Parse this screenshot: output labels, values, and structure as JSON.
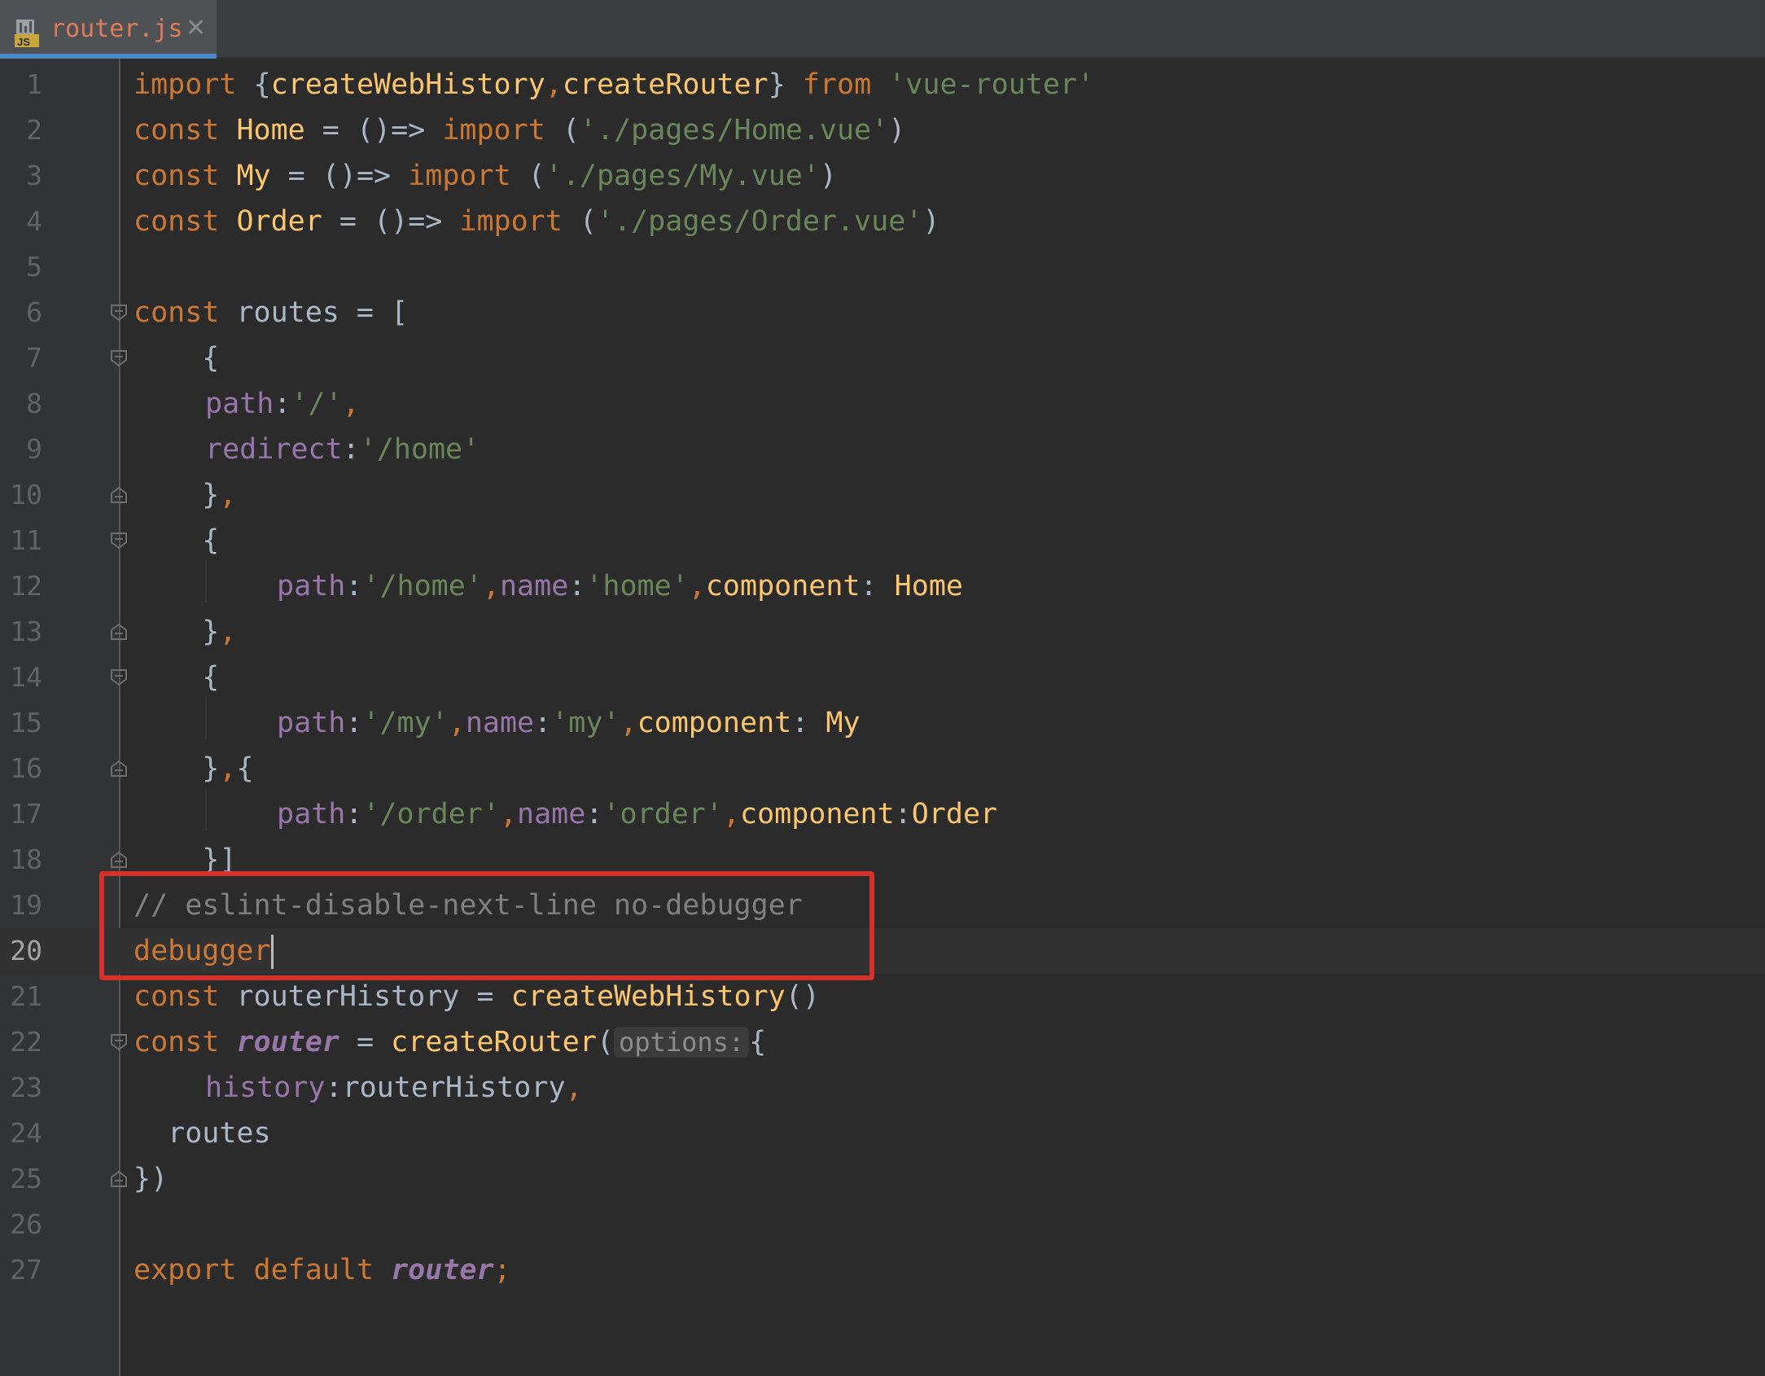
{
  "tab": {
    "filename": "router.js",
    "icon_label": "JS"
  },
  "icons": {
    "file_type": "js-file-icon",
    "close": "close-icon",
    "fold": "fold-marker-icon"
  },
  "colors": {
    "keyword": "#cc7832",
    "function": "#ffc66d",
    "string": "#6a8759",
    "property": "#9876aa",
    "comment": "#808080",
    "text": "#a9b7c6",
    "background": "#2b2b2b",
    "highlight_box": "#d4312c"
  },
  "editor": {
    "current_line": 20,
    "inlay_hint": "options:",
    "lines": [
      {
        "n": "1",
        "t1": "import",
        "t2": " {",
        "t3": "createWebHistory",
        "t4": ",",
        "t5": "createRouter",
        "t6": "} ",
        "t7": "from",
        "t8": " ",
        "t9": "'vue-router'"
      },
      {
        "n": "2",
        "t1": "const",
        "t2": " ",
        "t3": "Home",
        "t4": " = ()=> ",
        "t5": "import",
        "t6": " (",
        "t7": "'./pages/Home.vue'",
        "t8": ")"
      },
      {
        "n": "3",
        "t1": "const",
        "t2": " ",
        "t3": "My",
        "t4": " = ()=> ",
        "t5": "import",
        "t6": " (",
        "t7": "'./pages/My.vue'",
        "t8": ")"
      },
      {
        "n": "4",
        "t1": "const",
        "t2": " ",
        "t3": "Order",
        "t4": " = ()=> ",
        "t5": "import",
        "t6": " (",
        "t7": "'./pages/Order.vue'",
        "t8": ")"
      },
      {
        "n": "5"
      },
      {
        "n": "6",
        "t1": "const",
        "t2": " routes = ["
      },
      {
        "n": "7",
        "t1": "    {"
      },
      {
        "n": "8",
        "t1": "path",
        "t2": ":",
        "t3": "'/'",
        "t4": ","
      },
      {
        "n": "9",
        "t1": "redirect",
        "t2": ":",
        "t3": "'/home'"
      },
      {
        "n": "10",
        "t1": "    }",
        "t2": ","
      },
      {
        "n": "11",
        "t1": "    {"
      },
      {
        "n": "12",
        "t1": "path",
        "t2": ":",
        "t3": "'/home'",
        "t4": ",",
        "t5": "name",
        "t6": ":",
        "t7": "'home'",
        "t8": ",",
        "t9": "component",
        "t10": ": ",
        "t11": "Home"
      },
      {
        "n": "13",
        "t1": "    }",
        "t2": ","
      },
      {
        "n": "14",
        "t1": "    {"
      },
      {
        "n": "15",
        "t1": "path",
        "t2": ":",
        "t3": "'/my'",
        "t4": ",",
        "t5": "name",
        "t6": ":",
        "t7": "'my'",
        "t8": ",",
        "t9": "component",
        "t10": ": ",
        "t11": "My"
      },
      {
        "n": "16",
        "t1": "    }",
        "t2": ",",
        "t3": "{"
      },
      {
        "n": "17",
        "t1": "path",
        "t2": ":",
        "t3": "'/order'",
        "t4": ",",
        "t5": "name",
        "t6": ":",
        "t7": "'order'",
        "t8": ",",
        "t9": "component",
        "t10": ":",
        "t11": "Order"
      },
      {
        "n": "18",
        "t1": "    }]"
      },
      {
        "n": "19",
        "t1": "// eslint-disable-next-line no-debugger"
      },
      {
        "n": "20",
        "t1": "debugger"
      },
      {
        "n": "21",
        "t1": "const",
        "t2": " routerHistory = ",
        "t3": "createWebHistory",
        "t4": "()"
      },
      {
        "n": "22",
        "t1": "const",
        "t2": " ",
        "t3": "router",
        "t4": " = ",
        "t5": "createRouter",
        "t6": "(",
        "t7": "{"
      },
      {
        "n": "23",
        "t1": "history",
        "t2": ":routerHistory",
        "t3": ","
      },
      {
        "n": "24",
        "t1": "  routes"
      },
      {
        "n": "25",
        "t1": "})"
      },
      {
        "n": "26"
      },
      {
        "n": "27",
        "t1": "export",
        "t2": " ",
        "t3": "default",
        "t4": " ",
        "t5": "router",
        "t6": ";"
      }
    ]
  }
}
